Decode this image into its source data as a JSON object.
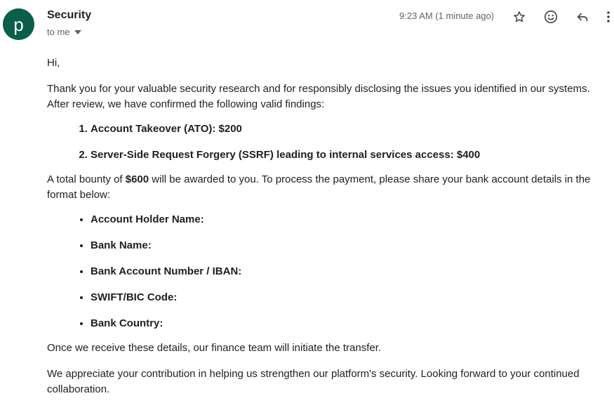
{
  "header": {
    "avatar_letter": "p",
    "avatar_color": "#0b5e49",
    "sender": "Security",
    "recipient": "to me",
    "timestamp": "9:23 AM (1 minute ago)",
    "icons": [
      "star-icon",
      "emoji-icon",
      "reply-icon",
      "more-vert-icon"
    ]
  },
  "body": {
    "greeting": "Hi,",
    "intro": "Thank you for your valuable security research and for responsibly disclosing the issues you identified in our systems. After review, we have confirmed the following valid findings:",
    "findings": [
      "Account Takeover (ATO): $200",
      "Server-Side Request Forgery (SSRF) leading to internal services access: $400"
    ],
    "bounty_prefix": "A total bounty of ",
    "bounty_amount": "$600",
    "bounty_suffix": " will be awarded to you. To process the payment, please share your bank account details in the format below:",
    "fields": [
      "Account Holder Name:",
      "Bank Name:",
      "Bank Account Number / IBAN:",
      "SWIFT/BIC Code:",
      "Bank Country:"
    ],
    "closing": "Once we receive these details, our finance team will initiate the transfer.",
    "appreciation": "We appreciate your contribution in helping us strengthen our platform's security. Looking forward to your continued collaboration."
  }
}
